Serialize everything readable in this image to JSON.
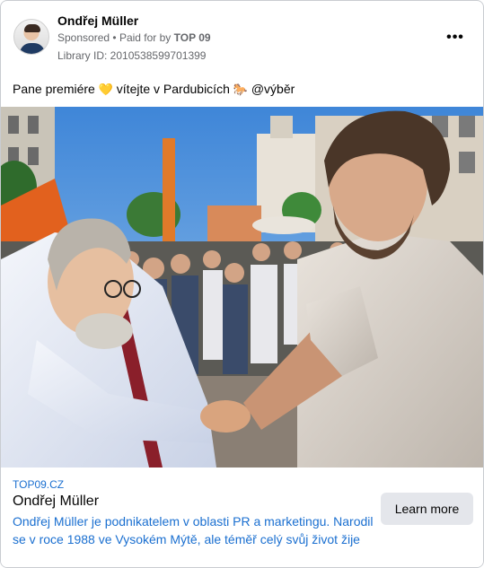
{
  "header": {
    "page_name": "Ondřej Müller",
    "sponsored": "Sponsored",
    "separator": "•",
    "paid_for_by": "Paid for by",
    "payer": "TOP 09",
    "library_id": "Library ID: 2010538599701399",
    "more_icon": "more-horizontal-icon"
  },
  "post": {
    "text_before": "Pane premiére",
    "emoji_1": "💛",
    "text_middle": "vítejte v Pardubicích",
    "emoji_2": "🐎",
    "text_after": "@výběr"
  },
  "link": {
    "domain": "TOP09.CZ",
    "title": "Ondřej Müller",
    "description": "Ondřej Müller je podnikatelem v oblasti PR a marketingu. Narodil se v roce 1988 ve Vysokém Mýtě, ale téměř celý svůj život žije v…",
    "cta": "Learn more"
  }
}
